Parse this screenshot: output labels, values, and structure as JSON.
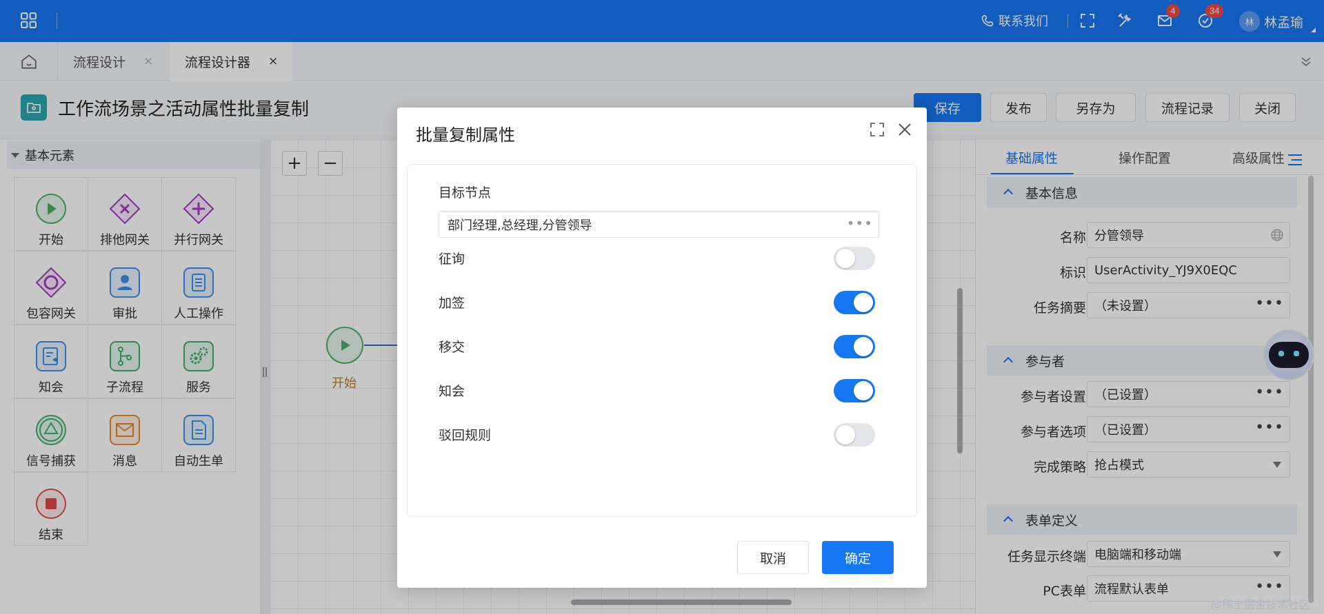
{
  "topbar": {
    "contact_label": "联系我们",
    "mail_badge": "4",
    "todo_badge": "34",
    "avatar_text": "林",
    "username": "林孟瑜"
  },
  "tabs": {
    "items": [
      {
        "label": "流程设计",
        "close": "×"
      },
      {
        "label": "流程设计器",
        "close": "×"
      }
    ]
  },
  "header": {
    "title": "工作流场景之活动属性批量复制",
    "buttons": [
      "保存",
      "发布",
      "另存为",
      "流程记录",
      "关闭"
    ]
  },
  "palette": {
    "title": "基本元素",
    "items": [
      {
        "label": "开始",
        "icon": "start-icon",
        "color": "#4caf6a"
      },
      {
        "label": "排他网关",
        "icon": "exclusive-gateway-icon",
        "color": "#a23bbf"
      },
      {
        "label": "并行网关",
        "icon": "parallel-gateway-icon",
        "color": "#a23bbf"
      },
      {
        "label": "包容网关",
        "icon": "inclusive-gateway-icon",
        "color": "#a23bbf"
      },
      {
        "label": "审批",
        "icon": "approval-user-icon",
        "color": "#3d8fe6"
      },
      {
        "label": "人工操作",
        "icon": "manual-task-icon",
        "color": "#3d8fe6"
      },
      {
        "label": "知会",
        "icon": "notify-icon",
        "color": "#3d8fe6"
      },
      {
        "label": "子流程",
        "icon": "subprocess-icon",
        "color": "#3eae68"
      },
      {
        "label": "服务",
        "icon": "service-gear-icon",
        "color": "#3eae68"
      },
      {
        "label": "信号捕获",
        "icon": "signal-catch-icon",
        "color": "#3eae68"
      },
      {
        "label": "消息",
        "icon": "message-icon",
        "color": "#e58a2c"
      },
      {
        "label": "自动生单",
        "icon": "auto-document-icon",
        "color": "#3d8fe6"
      },
      {
        "label": "结束",
        "icon": "end-icon",
        "color": "#e04848"
      }
    ]
  },
  "canvas": {
    "zoom_in": "+",
    "zoom_out": "−",
    "start_node_label": "开始"
  },
  "properties": {
    "tabs": [
      "基础属性",
      "操作配置",
      "高级属性"
    ],
    "sections": {
      "basic": "基本信息",
      "participants": "参与者",
      "form": "表单定义"
    },
    "fields": {
      "name": {
        "label": "名称",
        "value": "分管领导"
      },
      "id": {
        "label": "标识",
        "value": "UserActivity_YJ9X0EQC"
      },
      "summary": {
        "label": "任务摘要",
        "value": "（未设置）"
      },
      "participant_settings": {
        "label": "参与者设置",
        "value": "（已设置）"
      },
      "participant_options": {
        "label": "参与者选项",
        "value": "（已设置）"
      },
      "completion_strategy": {
        "label": "完成策略",
        "value": "抢占模式"
      },
      "display_terminal": {
        "label": "任务显示终端",
        "value": "电脑端和移动端"
      },
      "pc_form": {
        "label": "PC表单",
        "value": "流程默认表单"
      }
    }
  },
  "modal": {
    "title": "批量复制属性",
    "target_label": "目标节点",
    "target_value": "部门经理,总经理,分管领导",
    "options": [
      {
        "label": "征询",
        "on": false
      },
      {
        "label": "加签",
        "on": true
      },
      {
        "label": "移交",
        "on": true
      },
      {
        "label": "知会",
        "on": true
      },
      {
        "label": "驳回规则",
        "on": false
      }
    ],
    "cancel_label": "取消",
    "confirm_label": "确定"
  },
  "watermark": "@稀土掘金技术社区",
  "colors": {
    "primary": "#1677f2",
    "badge": "#ef4b4b"
  }
}
